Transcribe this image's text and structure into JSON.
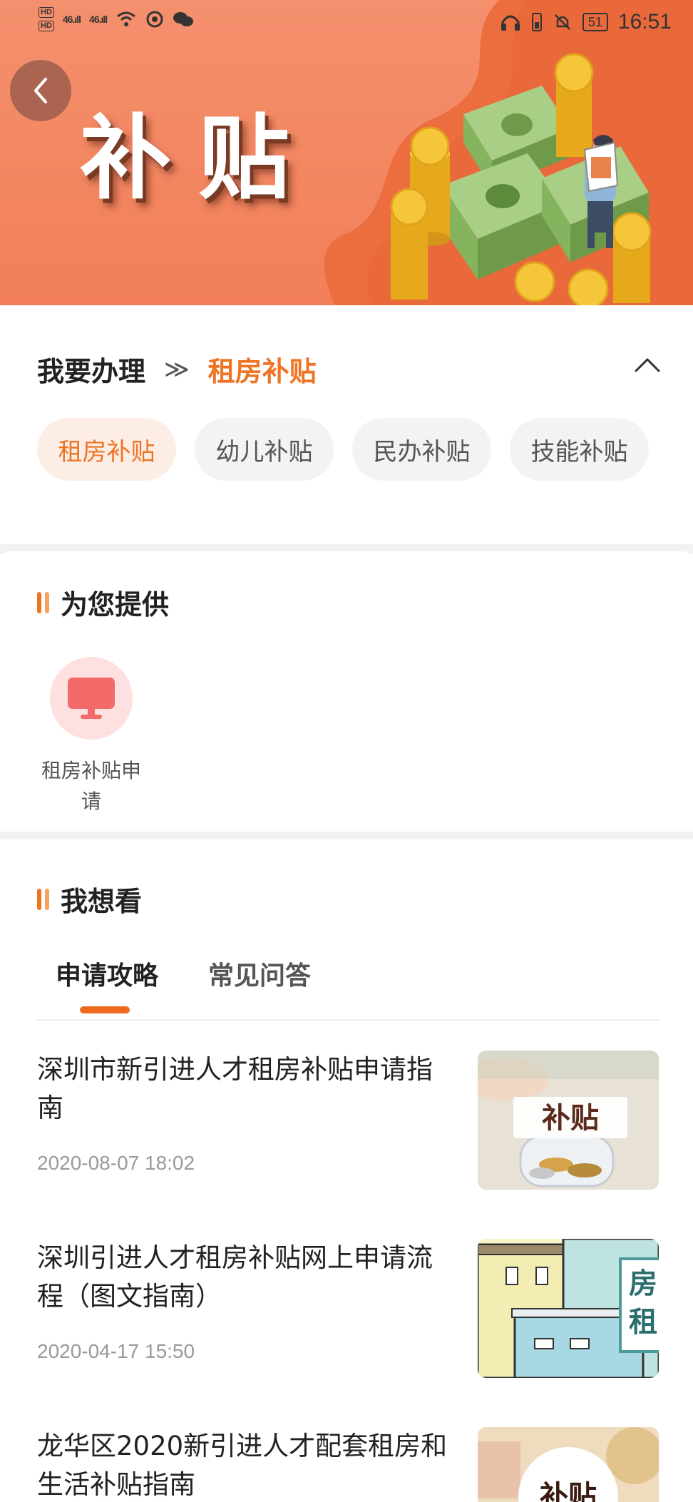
{
  "status_bar": {
    "hd_top": "HD",
    "hd_bottom": "HD",
    "signal_1": "46.ıll",
    "signal_2": "46.ıll",
    "battery_level": "51",
    "time": "16:51"
  },
  "banner": {
    "title": "补贴",
    "back_icon": "chevron-left-icon"
  },
  "handle": {
    "title": "我要办理",
    "separator": "≫",
    "current": "租房补贴",
    "collapse_icon": "chevron-up-icon",
    "chips": [
      "租房补贴",
      "幼儿补贴",
      "民办补贴",
      "技能补贴"
    ],
    "active_chip": 0
  },
  "provide": {
    "title": "为您提供",
    "services": [
      {
        "label": "租房补贴申请",
        "icon": "monitor-icon"
      }
    ]
  },
  "watch": {
    "title": "我想看",
    "tabs": [
      "申请攻略",
      "常见问答"
    ],
    "active_tab": 0,
    "articles": [
      {
        "title": "深圳市新引进人才租房补贴申请指南",
        "date": "2020-08-07 18:02",
        "thumb_text": "补贴"
      },
      {
        "title": "深圳引进人才租房补贴网上申请流程（图文指南）",
        "date": "2020-04-17 15:50",
        "thumb_text": "房租"
      },
      {
        "title": "龙华区2020新引进人才配套租房和生活补贴指南",
        "date": "",
        "thumb_text": "补贴"
      }
    ]
  },
  "colors": {
    "accent": "#ee7424",
    "banner": "#f4906e",
    "chip_bg": "#f3f3f3",
    "chip_active_bg": "#fdeee5"
  }
}
